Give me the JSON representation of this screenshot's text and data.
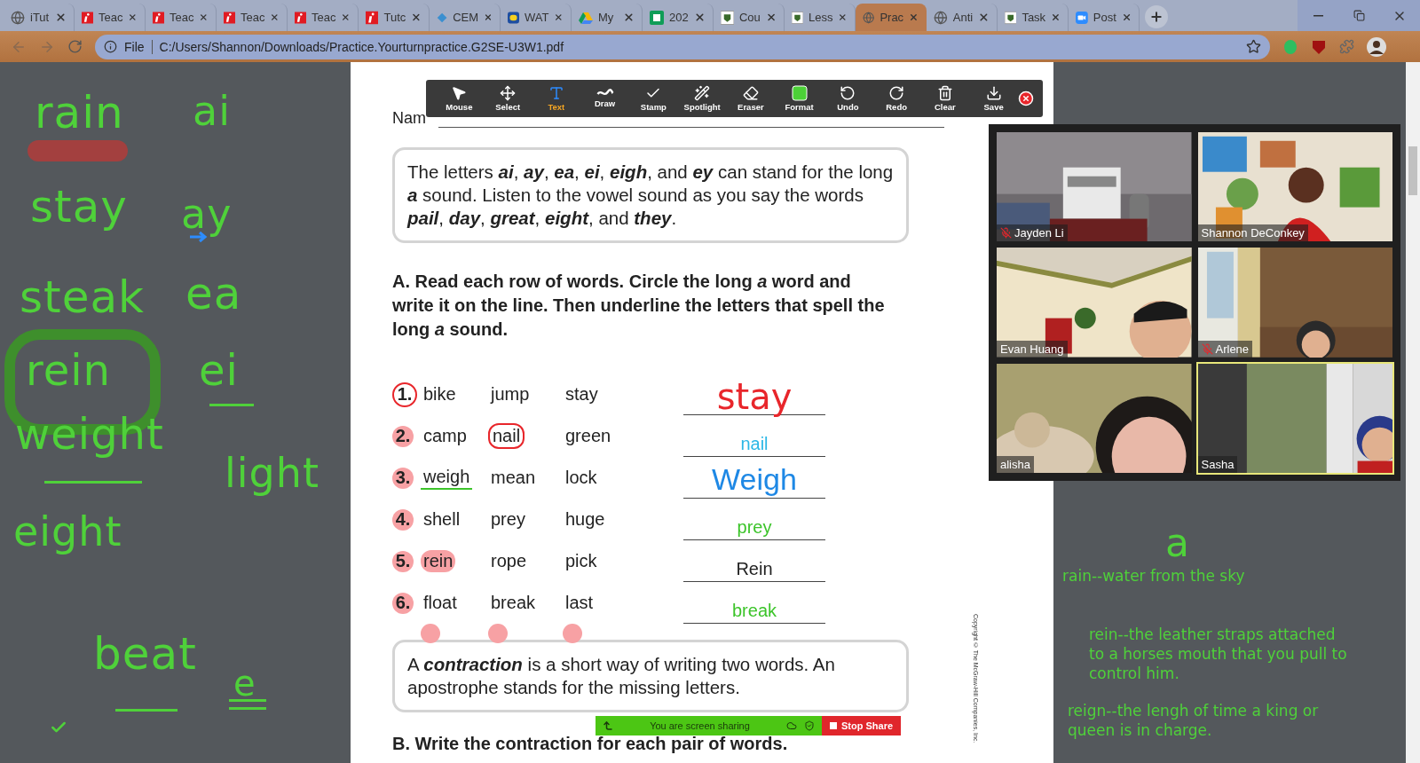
{
  "browser": {
    "tabs": [
      {
        "label": "iTut",
        "kind": "globe",
        "selected": false
      },
      {
        "label": "Teac",
        "kind": "red-i",
        "selected": false
      },
      {
        "label": "Teac",
        "kind": "red-i",
        "selected": false
      },
      {
        "label": "Teac",
        "kind": "red-i",
        "selected": false
      },
      {
        "label": "Teac",
        "kind": "red-i",
        "selected": false
      },
      {
        "label": "Tutc",
        "kind": "red-i",
        "selected": false
      },
      {
        "label": "CEM",
        "kind": "diamond",
        "selected": false
      },
      {
        "label": "WAT",
        "kind": "badge",
        "selected": false
      },
      {
        "label": "My",
        "kind": "drive",
        "selected": false
      },
      {
        "label": "202",
        "kind": "sheet",
        "selected": false
      },
      {
        "label": "Cou",
        "kind": "school",
        "selected": false
      },
      {
        "label": "Less",
        "kind": "school",
        "selected": false
      },
      {
        "label": "Prac",
        "kind": "globe",
        "selected": true
      },
      {
        "label": "Anti",
        "kind": "globe",
        "selected": false
      },
      {
        "label": "Task",
        "kind": "school",
        "selected": false
      },
      {
        "label": "Post",
        "kind": "zoom",
        "selected": false
      }
    ],
    "address": {
      "scheme": "File",
      "url": "C:/Users/Shannon/Downloads/Practice.Yourturnpractice.G2SE-U3W1.pdf"
    }
  },
  "left_notes": [
    {
      "text": "rain"
    },
    {
      "text": "ai"
    },
    {
      "text": "stay"
    },
    {
      "text": "ay"
    },
    {
      "text": "steak"
    },
    {
      "text": "ea"
    },
    {
      "text": "rein"
    },
    {
      "text": "ei"
    },
    {
      "text": "weight"
    },
    {
      "text": "light"
    },
    {
      "text": "eight"
    },
    {
      "text": "beat"
    },
    {
      "text": "e"
    }
  ],
  "toolbar": [
    {
      "label": "Mouse",
      "selected": false
    },
    {
      "label": "Select",
      "selected": false
    },
    {
      "label": "Text",
      "selected": true
    },
    {
      "label": "Draw",
      "selected": false
    },
    {
      "label": "Stamp",
      "selected": false
    },
    {
      "label": "Spotlight",
      "selected": false
    },
    {
      "label": "Eraser",
      "selected": false
    },
    {
      "label": "Format",
      "selected": false
    },
    {
      "label": "Undo",
      "selected": false
    },
    {
      "label": "Redo",
      "selected": false
    },
    {
      "label": "Clear",
      "selected": false
    },
    {
      "label": "Save",
      "selected": false
    }
  ],
  "worksheet": {
    "name_label": "Nam",
    "intro": "The letters **ai**, **ay**, **ea**, **ei**, **eigh**, and **ey** can stand for the long **a** sound. Listen to the vowel sound as you say the words **pail**, **day**, **great**, **eight**, and **they**.",
    "heading_a": "A. Read each row of words. Circle the long *a* word and write it on the line. Then underline the letters that spell the long *a* sound.",
    "rows": [
      {
        "number": {
          "text": "1.",
          "kind": "circled"
        },
        "words": [
          {
            "text": "bike",
            "kind": "plain"
          },
          {
            "text": "jump",
            "kind": "plain"
          },
          {
            "text": "stay",
            "kind": "plain"
          }
        ],
        "answer": {
          "text": "stay",
          "kind": "handwriting",
          "color": "#e8262b"
        }
      },
      {
        "number": {
          "text": "2.",
          "kind": "dotted"
        },
        "words": [
          {
            "text": "camp",
            "kind": "plain"
          },
          {
            "text": "nail",
            "kind": "circled"
          },
          {
            "text": "green",
            "kind": "plain"
          }
        ],
        "answer": {
          "text": "nail",
          "kind": "typed",
          "color": "#2bb7e6"
        }
      },
      {
        "number": {
          "text": "3.",
          "kind": "dotted"
        },
        "words": [
          {
            "text": "weigh",
            "kind": "underlined"
          },
          {
            "text": "mean",
            "kind": "plain"
          },
          {
            "text": "lock",
            "kind": "plain"
          }
        ],
        "answer": {
          "text": "Weigh",
          "kind": "typed-large",
          "color": "#1e88e5"
        }
      },
      {
        "number": {
          "text": "4.",
          "kind": "dotted"
        },
        "words": [
          {
            "text": "shell",
            "kind": "plain"
          },
          {
            "text": "prey",
            "kind": "plain"
          },
          {
            "text": "huge",
            "kind": "plain"
          }
        ],
        "answer": {
          "text": "prey",
          "kind": "typed",
          "color": "#3cc42a"
        }
      },
      {
        "number": {
          "text": "5.",
          "kind": "dotted"
        },
        "words": [
          {
            "text": "rein",
            "kind": "highlighted"
          },
          {
            "text": "rope",
            "kind": "plain"
          },
          {
            "text": "pick",
            "kind": "plain"
          }
        ],
        "answer": {
          "text": "Rein",
          "kind": "typed",
          "color": "#222222"
        }
      },
      {
        "number": {
          "text": "6.",
          "kind": "dotted"
        },
        "words": [
          {
            "text": "float",
            "kind": "plain"
          },
          {
            "text": "break",
            "kind": "plain"
          },
          {
            "text": "last",
            "kind": "plain"
          }
        ],
        "answer": {
          "text": "break",
          "kind": "typed",
          "color": "#3cc42a"
        }
      }
    ],
    "contraction": "A **contraction** is a short way of writing two words. An apostrophe stands for the missing letters.",
    "heading_b": "B. Write the contraction for each pair of words.",
    "copyright": "Copyright © The McGraw-Hill Companies, Inc."
  },
  "share_bar": {
    "status": "You are screen sharing",
    "stop": "Stop Share"
  },
  "video": [
    {
      "name": "Jayden Li",
      "muted": true,
      "active": false
    },
    {
      "name": "Shannon DeConkey",
      "muted": false,
      "active": false
    },
    {
      "name": "Evan Huang",
      "muted": false,
      "active": false
    },
    {
      "name": "Arlene",
      "muted": true,
      "active": false
    },
    {
      "name": "alisha",
      "muted": false,
      "active": false
    },
    {
      "name": "Sasha",
      "muted": false,
      "active": true
    }
  ],
  "right_notes": {
    "letter": "a",
    "definitions": [
      "rain--water from the sky",
      "rein--the leather straps attached to a horses mouth that you pull to control him.",
      "reign--the lengh of time a king or queen is in charge."
    ]
  }
}
